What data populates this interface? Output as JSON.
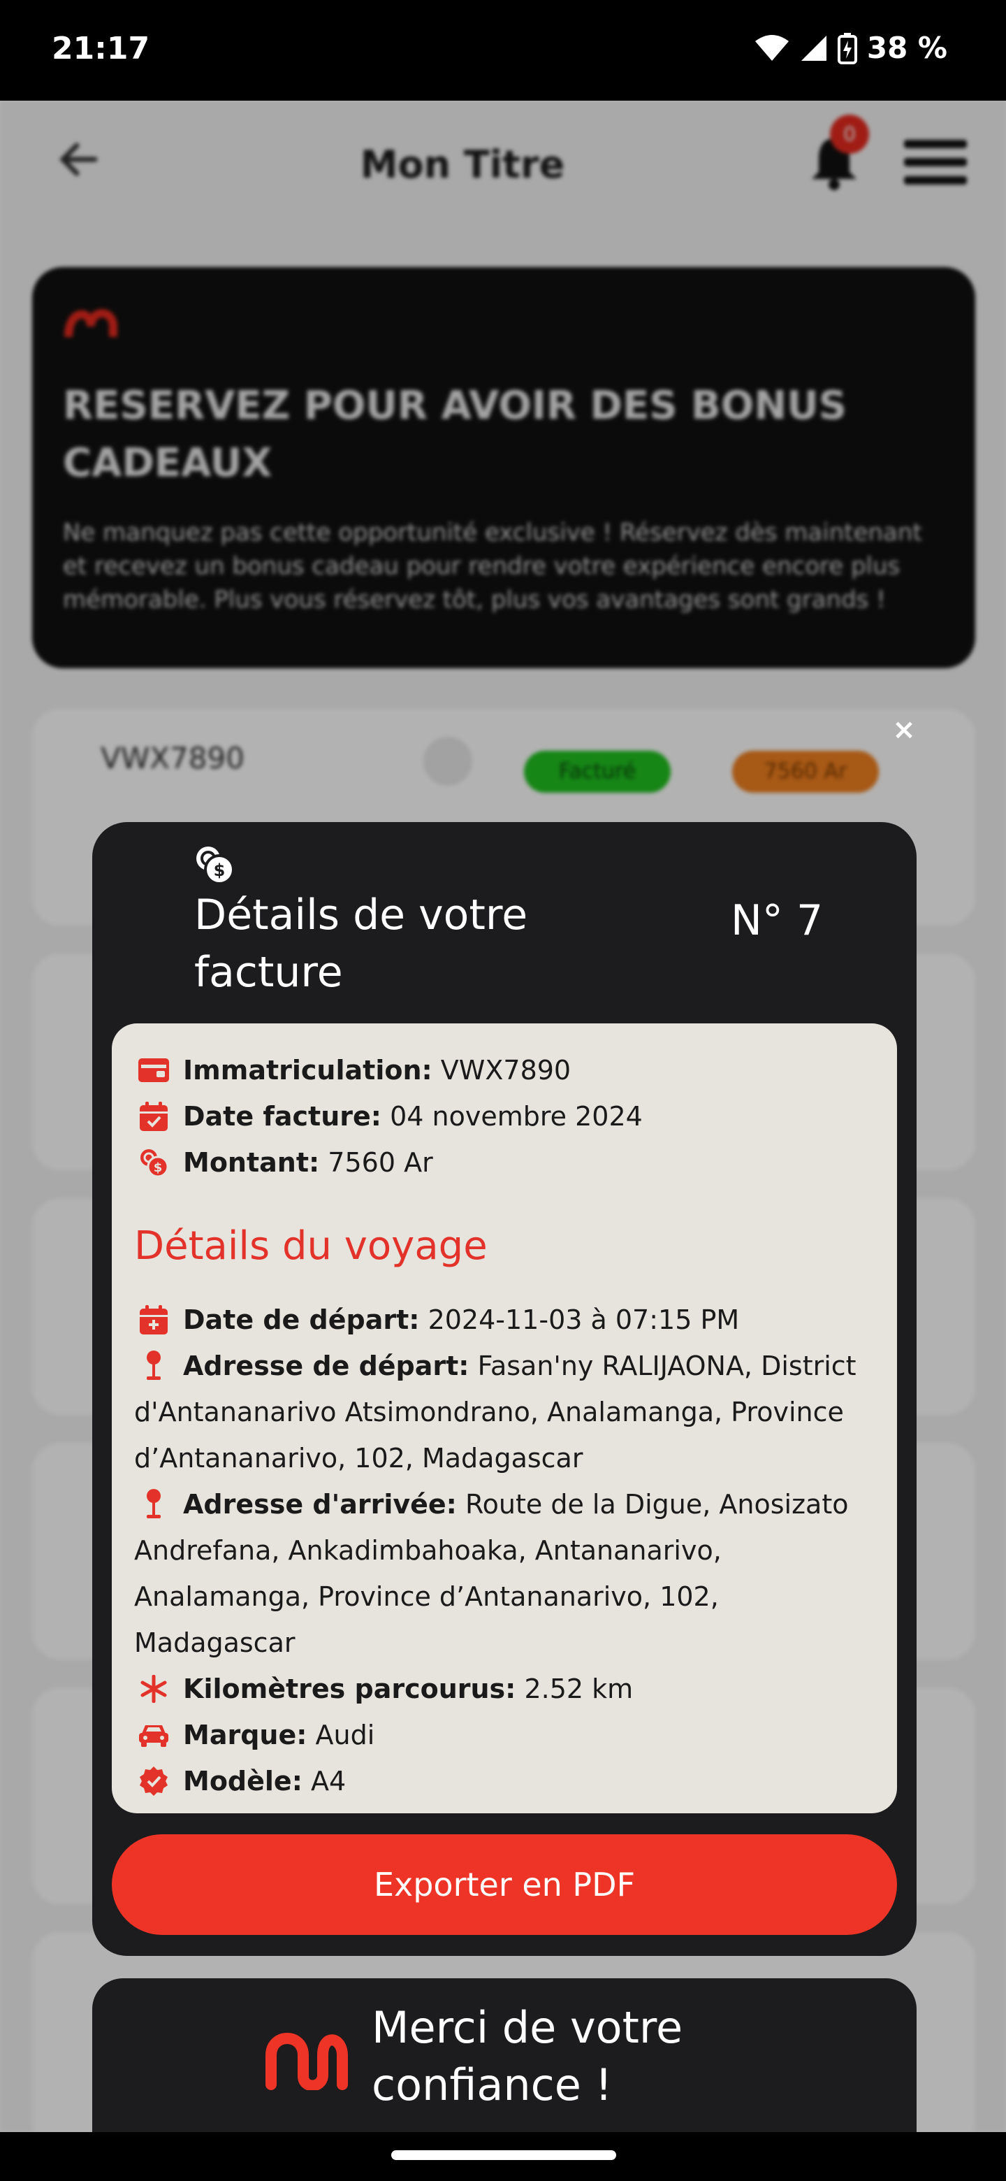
{
  "status_bar": {
    "time": "21:17",
    "battery": "38 %",
    "icons": [
      "wifi-icon",
      "signal-icon",
      "battery-icon"
    ]
  },
  "app": {
    "title": "Mon Titre",
    "notification_count": "0",
    "promo": {
      "title": "RESERVEZ POUR AVOIR DES BONUS CADEAUX",
      "text": "Ne manquez pas cette opportunité exclusive ! Réservez dès maintenant et recevez un bonus cadeau pour rendre votre expérience encore plus mémorable. Plus vous réservez tôt, plus vos avantages sont grands !"
    },
    "card": {
      "plate": "VWX7890",
      "status": "Facturé",
      "amount": "7560 Ar"
    }
  },
  "modal": {
    "close": "×",
    "title": "Détails de votre facture",
    "number": "N° 7",
    "invoice": {
      "registration_label": "Immatriculation:",
      "registration_value": "VWX7890",
      "date_label": "Date facture:",
      "date_value": "04 novembre 2024",
      "amount_label": "Montant:",
      "amount_value": "7560 Ar"
    },
    "trip": {
      "section_title": "Détails du voyage",
      "departure_date_label": "Date de départ:",
      "departure_date_value": "2024-11-03 à 07:15 PM",
      "departure_address_label": "Adresse de départ:",
      "departure_address_value": "Fasan'ny RALIJAONA, District d'Antananarivo Atsimondrano, Analamanga, Province d’Antananarivo, 102, Madagascar",
      "arrival_address_label": "Adresse d'arrivée:",
      "arrival_address_value": "Route de la Digue, Anosizato Andrefana, Ankadimbahoaka, Antananarivo, Analamanga, Province d’Antananarivo, 102, Madagascar",
      "distance_label": "Kilomètres parcourus:",
      "distance_value": "2.52 km",
      "brand_label": "Marque:",
      "brand_value": "Audi",
      "model_label": "Modèle:",
      "model_value": "A4"
    },
    "export_label": "Exporter en PDF"
  },
  "merci": {
    "text": "Merci de votre confiance !"
  },
  "colors": {
    "accent": "#ee3426",
    "modal_bg": "#1c1b1d",
    "panel_bg": "#e7e4de"
  }
}
